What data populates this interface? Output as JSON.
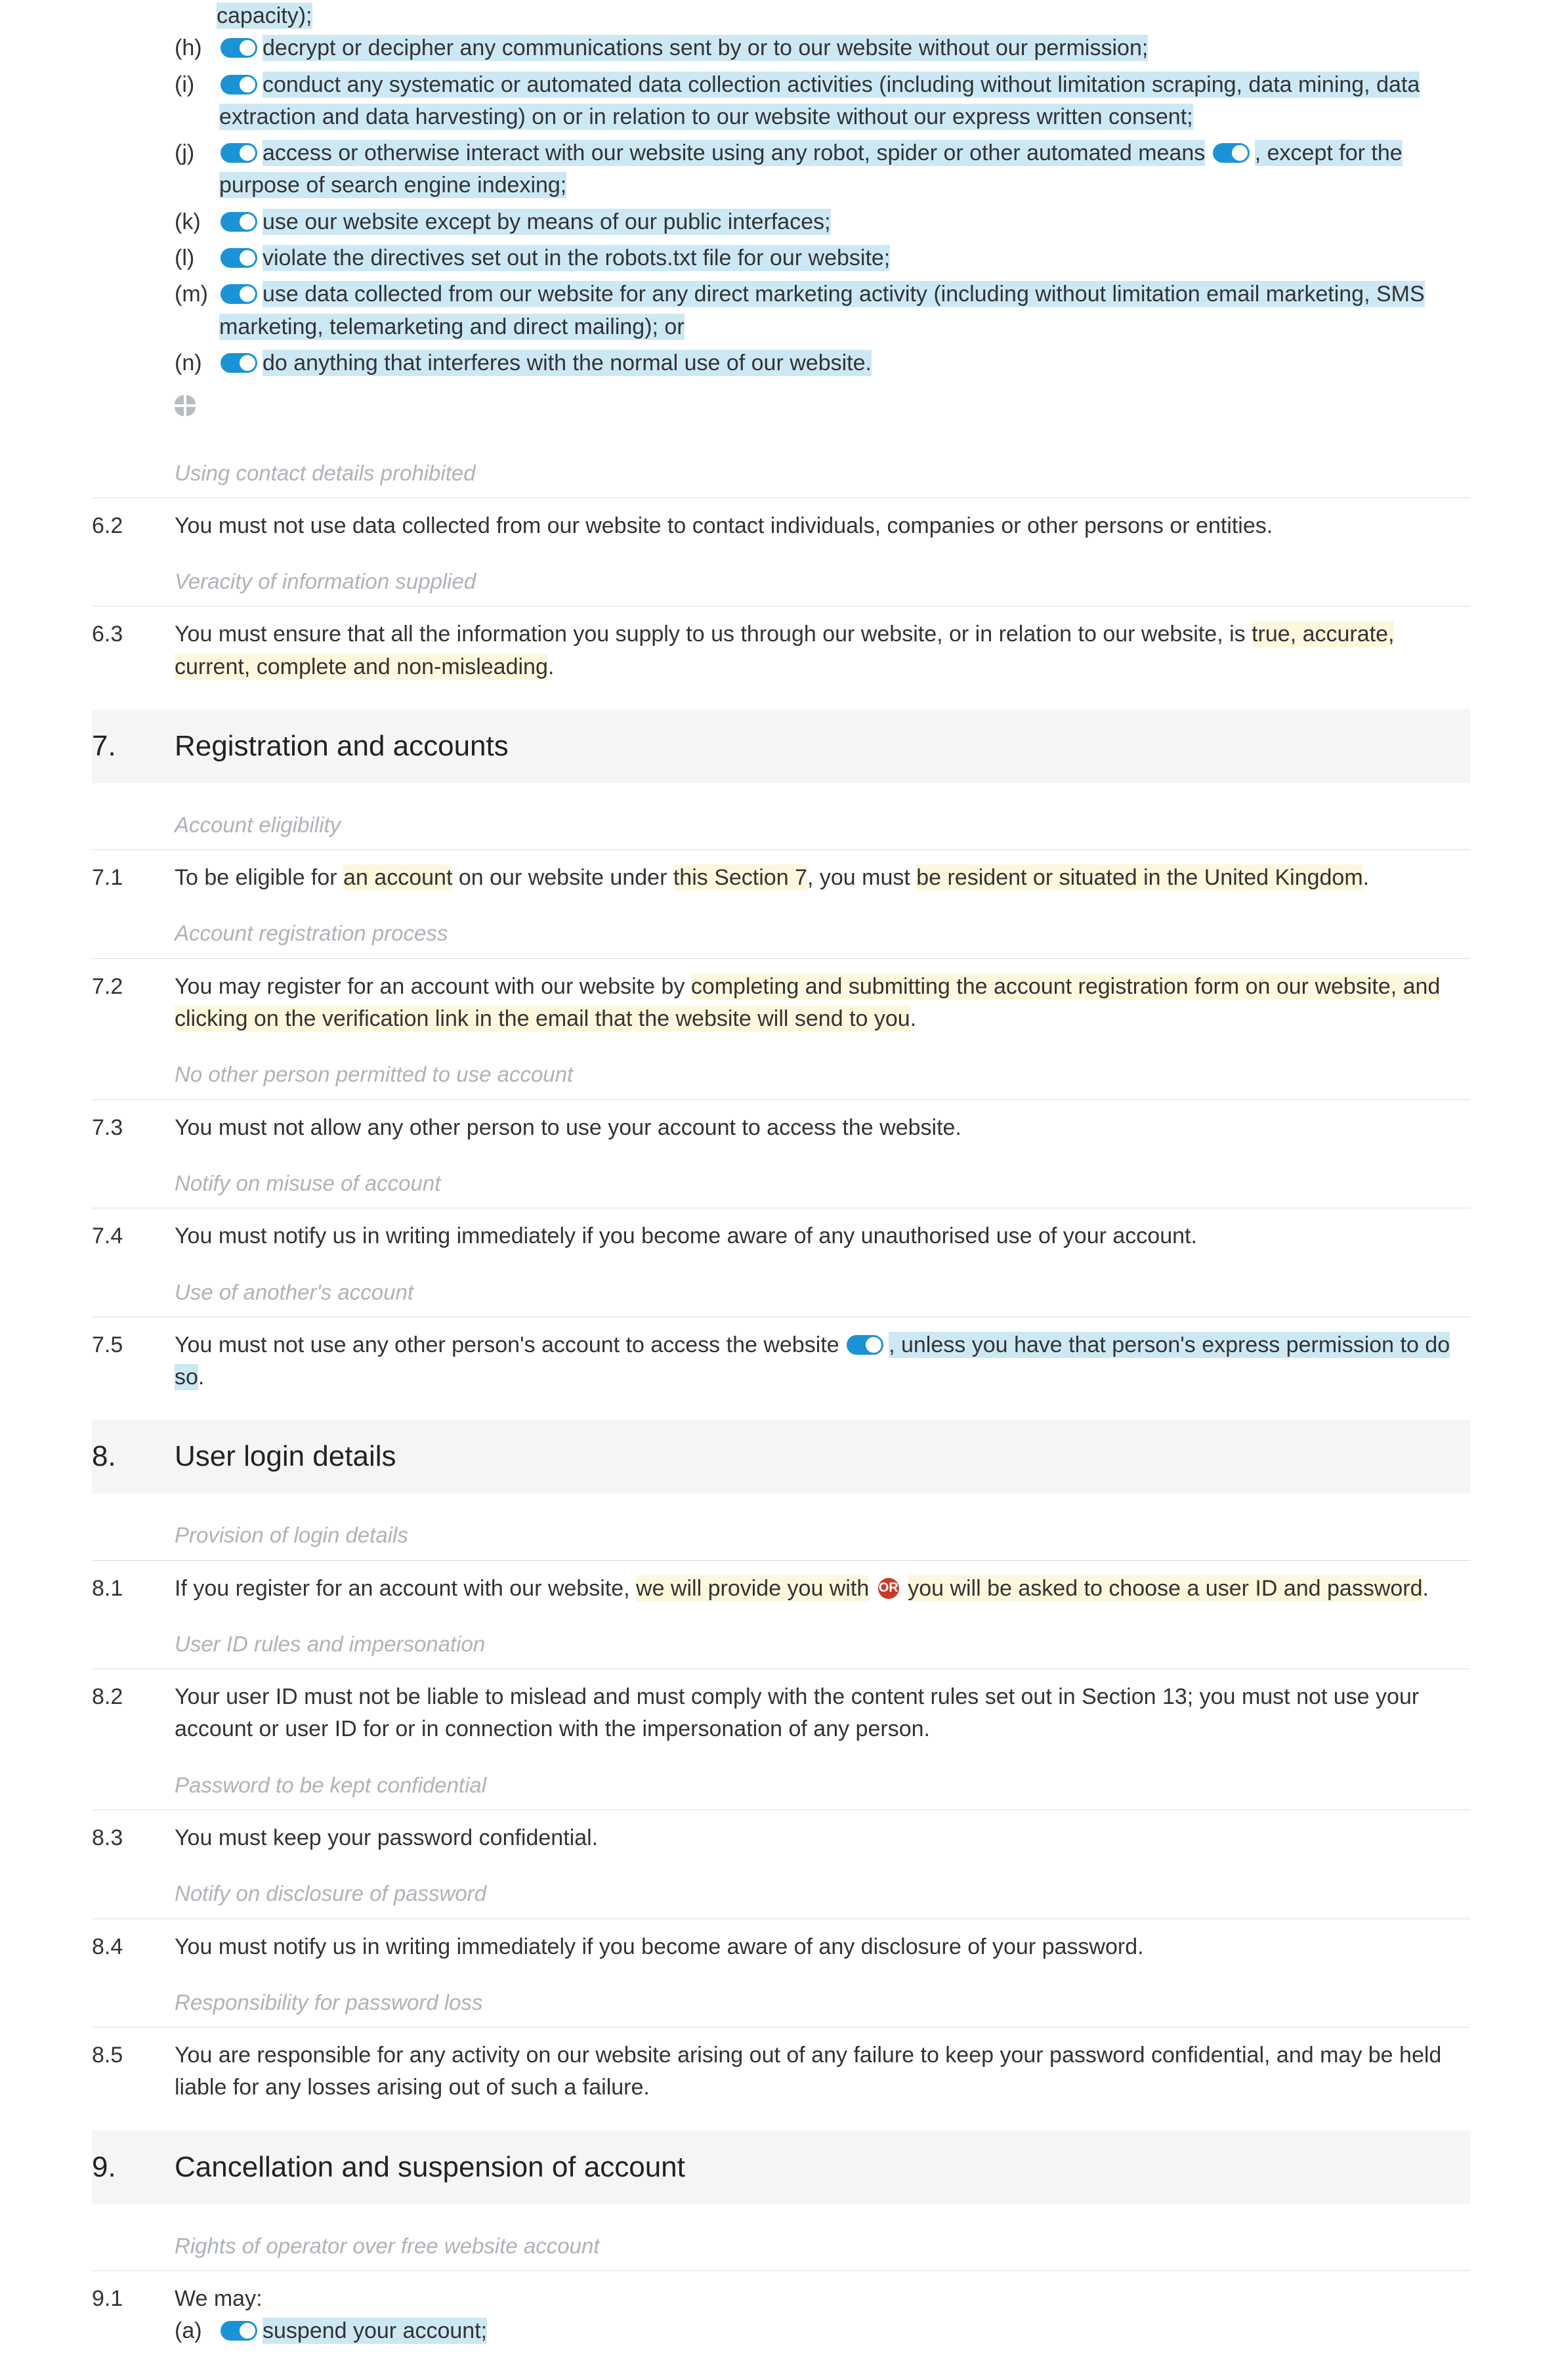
{
  "list6": {
    "tailH": "capacity);",
    "h_marker": "(h)",
    "h_text": "decrypt or decipher any communications sent by or to our website without our permission;",
    "i_marker": "(i)",
    "i_text": "conduct any systematic or automated data collection activities (including without limitation scraping, data mining, data extraction and data harvesting) on or in relation to our website without our express written consent;",
    "j_marker": "(j)",
    "j_t1": "access or otherwise interact with our website using any robot, spider or other automated means",
    "j_t2": ", except for the purpose of search engine indexing;",
    "k_marker": "(k)",
    "k_text": "use our website except by means of our public interfaces;",
    "l_marker": "(l)",
    "l_text": "violate the directives set out in the robots.txt file for our website;",
    "m_marker": "(m)",
    "m_text": "use data collected from our website for any direct marketing activity (including without limitation email marketing, SMS marketing, telemarketing and direct mailing); or",
    "n_marker": "(n)",
    "n_text": "do anything that interferes with the normal use of our website."
  },
  "notes": {
    "n62": "Using contact details prohibited",
    "n63": "Veracity of information supplied",
    "n71": "Account eligibility",
    "n72": "Account registration process",
    "n73": "No other person permitted to use account",
    "n74": "Notify on misuse of account",
    "n75": "Use of another's account",
    "n81": "Provision of login details",
    "n82": "User ID rules and impersonation",
    "n83": "Password to be kept confidential",
    "n84": "Notify on disclosure of password",
    "n85": "Responsibility for password loss",
    "n91": "Rights of operator over free website account"
  },
  "c62": {
    "num": "6.2",
    "text": "You must not use data collected from our website to contact individuals, companies or other persons or entities."
  },
  "c63": {
    "num": "6.3",
    "t1": "You must ensure that all the information you supply to us through our website, or in relation to our website, is ",
    "t2": "true, accurate, current, complete and non-misleading",
    "t3": "."
  },
  "s7": {
    "num": "7.",
    "title": "Registration and accounts"
  },
  "c71": {
    "num": "7.1",
    "t1": "To be eligible for ",
    "t2": "an account",
    "t3": " on our website under ",
    "t4": "this Section 7",
    "t5": ", you must ",
    "t6": "be resident or situated in the United Kingdom",
    "t7": "."
  },
  "c72": {
    "num": "7.2",
    "t1": "You may register for an account with our website by ",
    "t2": "completing and submitting the account registration form on our website, and clicking on the verification link in the email that the website will send to you",
    "t3": "."
  },
  "c73": {
    "num": "7.3",
    "text": "You must not allow any other person to use your account to access the website."
  },
  "c74": {
    "num": "7.4",
    "text": "You must notify us in writing immediately if you become aware of any unauthorised use of your account."
  },
  "c75": {
    "num": "7.5",
    "t1": "You must not use any other person's account to access the website",
    "t2": ", unless you have that person's express permission to do so",
    "t3": "."
  },
  "s8": {
    "num": "8.",
    "title": "User login details"
  },
  "c81": {
    "num": "8.1",
    "t1": "If you register for an account with our website, ",
    "t2": "we will provide you with",
    "or": "OR",
    "t3": "you will be asked to choose",
    "t4": " a user ID and password",
    "t5": "."
  },
  "c82": {
    "num": "8.2",
    "text": "Your user ID must not be liable to mislead and must comply with the content rules set out in Section 13; you must not use your account or user ID for or in connection with the impersonation of any person."
  },
  "c83": {
    "num": "8.3",
    "text": "You must keep your password confidential."
  },
  "c84": {
    "num": "8.4",
    "text": "You must notify us in writing immediately if you become aware of any disclosure of your password."
  },
  "c85": {
    "num": "8.5",
    "text": "You are responsible for any activity on our website arising out of any failure to keep your password confidential, and may be held liable for any losses arising out of such a failure."
  },
  "s9": {
    "num": "9.",
    "title": "Cancellation and suspension of account"
  },
  "c91": {
    "num": "9.1",
    "lead": "We may:",
    "a_marker": "(a)",
    "a_text": "suspend your account;"
  }
}
